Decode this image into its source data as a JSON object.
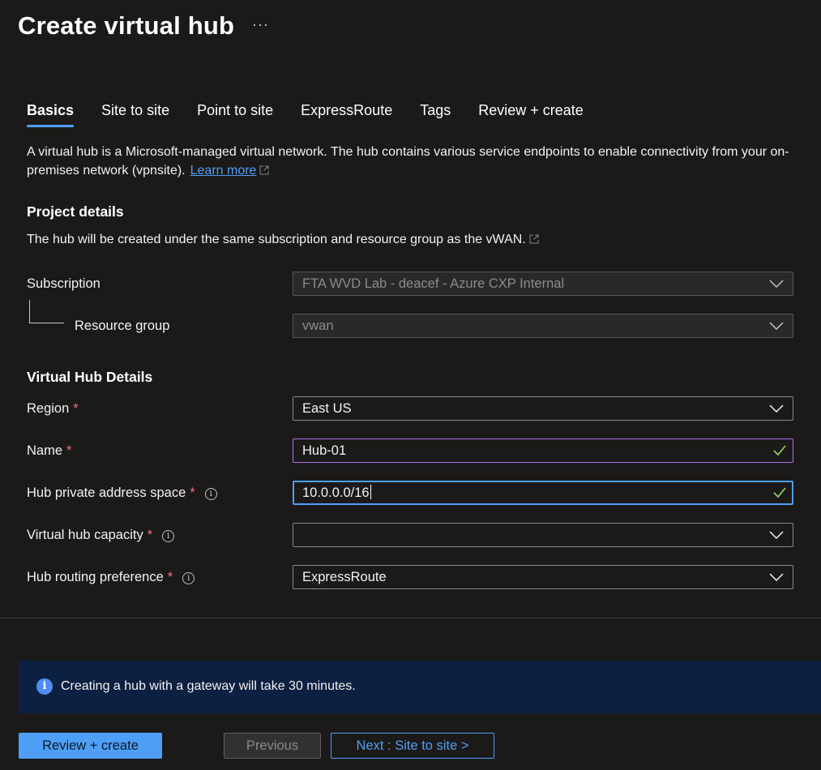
{
  "page": {
    "title": "Create virtual hub",
    "more_label": "···"
  },
  "tabs": [
    {
      "label": "Basics"
    },
    {
      "label": "Site to site"
    },
    {
      "label": "Point to site"
    },
    {
      "label": "ExpressRoute"
    },
    {
      "label": "Tags"
    },
    {
      "label": "Review + create"
    }
  ],
  "description": {
    "text": "A virtual hub is a Microsoft-managed virtual network. The hub contains various service endpoints to enable connectivity from your on-premises network (vpnsite).",
    "link_text": "Learn more"
  },
  "project_details": {
    "heading": "Project details",
    "note": "The hub will be created under the same subscription and resource group as the vWAN.",
    "subscription_label": "Subscription",
    "subscription_value": "FTA WVD Lab - deacef - Azure CXP Internal",
    "resource_group_label": "Resource group",
    "resource_group_value": "vwan"
  },
  "hub_details": {
    "heading": "Virtual Hub Details",
    "region_label": "Region",
    "region_value": "East US",
    "name_label": "Name",
    "name_value": "Hub-01",
    "address_label": "Hub private address space",
    "address_value": "10.0.0.0/16",
    "capacity_label": "Virtual hub capacity",
    "capacity_value": "",
    "routing_label": "Hub routing preference",
    "routing_value": "ExpressRoute",
    "required_mark": "*",
    "info_mark": "i"
  },
  "banner": {
    "icon_mark": "i",
    "text": "Creating a hub with a gateway will take 30 minutes."
  },
  "footer": {
    "review_label": "Review + create",
    "previous_label": "Previous",
    "next_label": "Next : Site to site >"
  },
  "colors": {
    "background": "#1b1a19",
    "accent": "#4f9ef6",
    "required": "#f1707b",
    "valid_check": "#9bd36b",
    "banner_bg": "#0c2042"
  }
}
